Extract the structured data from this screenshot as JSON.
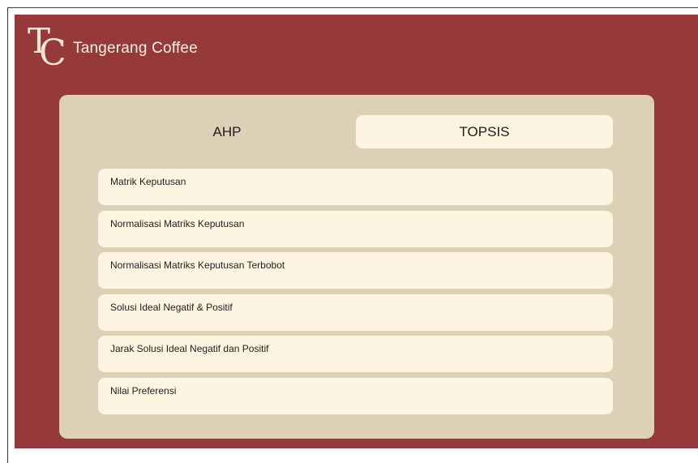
{
  "brand": {
    "logo_letters": "TC",
    "name": "Tangerang Coffee"
  },
  "tabs": [
    {
      "label": "AHP",
      "active": false
    },
    {
      "label": "TOPSIS",
      "active": true
    }
  ],
  "menu_items": [
    {
      "label": "Matrik Keputusan"
    },
    {
      "label": "Normalisasi Matriks Keputusan"
    },
    {
      "label": "Normalisasi Matriks Keputusan Terbobot"
    },
    {
      "label": "Solusi Ideal Negatif & Positif"
    },
    {
      "label": "Jarak Solusi Ideal Negatif dan Positif"
    },
    {
      "label": "Nilai Preferensi"
    }
  ],
  "colors": {
    "header_background": "#96393b",
    "panel_background": "#dcd0b6",
    "item_background": "#fdf5e1",
    "text_light": "#fbf1dd",
    "text_dark": "#1e1e1e"
  }
}
